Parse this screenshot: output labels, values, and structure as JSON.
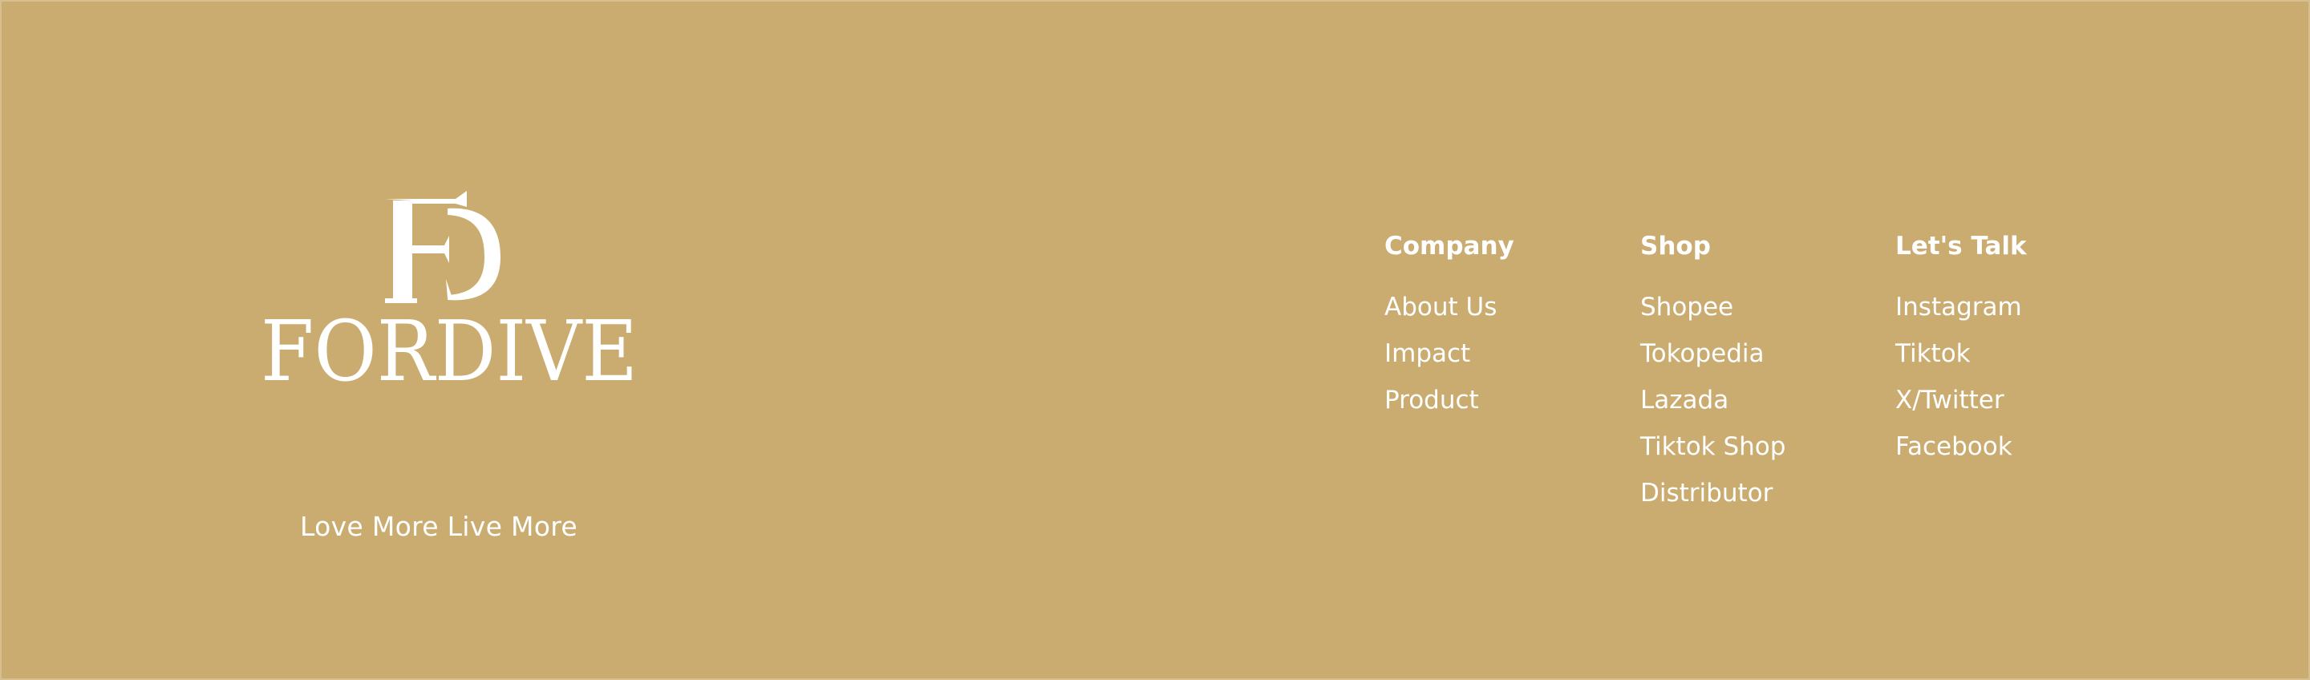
{
  "brand": {
    "monogram": "FD",
    "name": "FORDIVE",
    "tagline": "Love More Live More"
  },
  "colors": {
    "background": "#CAAC71",
    "text": "#FFFFFF"
  },
  "columns": {
    "company": {
      "heading": "Company",
      "links": [
        "About Us",
        "Impact",
        "Product"
      ]
    },
    "shop": {
      "heading": "Shop",
      "links": [
        "Shopee",
        "Tokopedia",
        "Lazada",
        "Tiktok Shop",
        "Distributor"
      ]
    },
    "talk": {
      "heading": "Let's Talk",
      "links": [
        "Instagram",
        "Tiktok",
        "X/Twitter",
        "Facebook"
      ]
    }
  }
}
